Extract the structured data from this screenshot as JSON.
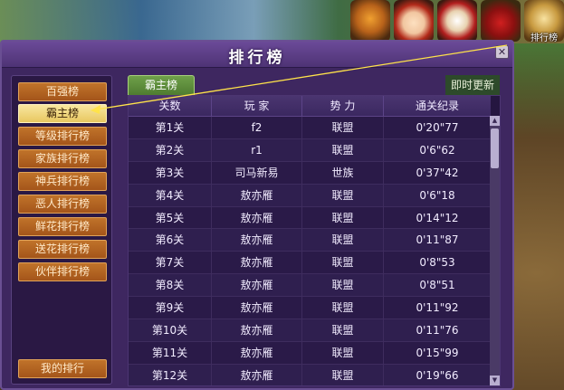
{
  "panel": {
    "title": "排行榜",
    "close_glyph": "✕"
  },
  "top_icons": [
    {
      "name": "tiger-icon",
      "label": ""
    },
    {
      "name": "warrior-avatar-icon",
      "label": ""
    },
    {
      "name": "banner-icon",
      "label": ""
    },
    {
      "name": "arena-icon",
      "label": ""
    },
    {
      "name": "scroll-rank-icon",
      "label": "排行榜"
    }
  ],
  "menu": {
    "items": [
      {
        "label": "百强榜",
        "active": false
      },
      {
        "label": "霸主榜",
        "active": true
      },
      {
        "label": "等级排行榜",
        "active": false
      },
      {
        "label": "家族排行榜",
        "active": false
      },
      {
        "label": "神兵排行榜",
        "active": false
      },
      {
        "label": "恶人排行榜",
        "active": false
      },
      {
        "label": "鲜花排行榜",
        "active": false
      },
      {
        "label": "送花排行榜",
        "active": false
      },
      {
        "label": "伙伴排行榜",
        "active": false
      }
    ],
    "my_rank_label": "我的排行"
  },
  "tab": {
    "label": "霸主榜"
  },
  "update_note": "即时更新",
  "table": {
    "headers": [
      "关数",
      "玩 家",
      "势 力",
      "通关纪录"
    ],
    "rows": [
      [
        "第1关",
        "f2",
        "联盟",
        "0'20\"77"
      ],
      [
        "第2关",
        "r1",
        "联盟",
        "0'6\"62"
      ],
      [
        "第3关",
        "司马新易",
        "世族",
        "0'37\"42"
      ],
      [
        "第4关",
        "敖亦雁",
        "联盟",
        "0'6\"18"
      ],
      [
        "第5关",
        "敖亦雁",
        "联盟",
        "0'14\"12"
      ],
      [
        "第6关",
        "敖亦雁",
        "联盟",
        "0'11\"87"
      ],
      [
        "第7关",
        "敖亦雁",
        "联盟",
        "0'8\"53"
      ],
      [
        "第8关",
        "敖亦雁",
        "联盟",
        "0'8\"51"
      ],
      [
        "第9关",
        "敖亦雁",
        "联盟",
        "0'11\"92"
      ],
      [
        "第10关",
        "敖亦雁",
        "联盟",
        "0'11\"76"
      ],
      [
        "第11关",
        "敖亦雁",
        "联盟",
        "0'15\"99"
      ],
      [
        "第12关",
        "敖亦雁",
        "联盟",
        "0'19\"66"
      ]
    ]
  },
  "colors": {
    "panel": "#3e2760",
    "menu_button": "#b5621f",
    "menu_button_active": "#f0d47c",
    "tab": "#5f8e3c",
    "guide_line": "#ffe34a"
  }
}
